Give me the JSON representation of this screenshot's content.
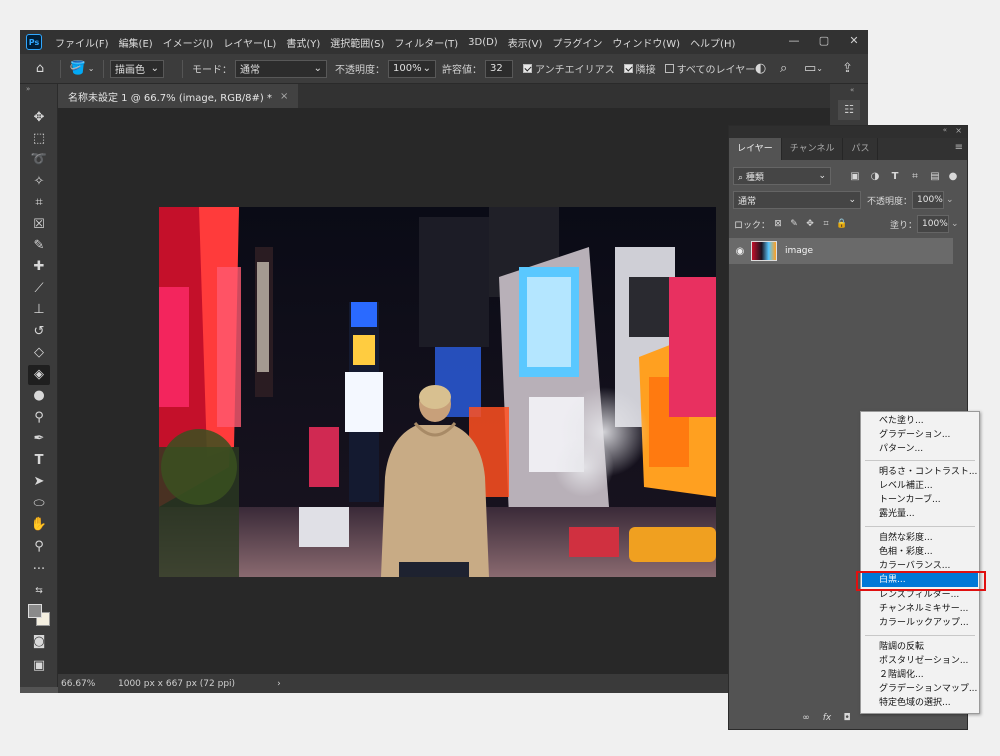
{
  "menubar": {
    "logo": "Ps",
    "items": [
      "ファイル(F)",
      "編集(E)",
      "イメージ(I)",
      "レイヤー(L)",
      "書式(Y)",
      "選択範囲(S)",
      "フィルター(T)",
      "3D(D)",
      "表示(V)",
      "プラグイン",
      "ウィンドウ(W)",
      "ヘルプ(H)"
    ],
    "controls": [
      "—",
      "▢",
      "✕"
    ]
  },
  "options": {
    "fill_source": "描画色",
    "mode_label": "モード：",
    "mode_value": "通常",
    "opacity_label": "不透明度：",
    "opacity_value": "100%",
    "tolerance_label": "許容値：",
    "tolerance_value": "32",
    "antialias_label": "アンチエイリアス",
    "contiguous_label": "隣接",
    "all_layers_label": "すべてのレイヤー"
  },
  "document": {
    "tab_title": "名称未設定 1 @ 66.7% (image, RGB/8#) *",
    "tab_close": "×"
  },
  "status": {
    "zoom": "66.67%",
    "info": "1000 px x 667 px (72 ppi)",
    "arrow": "›"
  },
  "layers_panel": {
    "tabs": [
      "レイヤー",
      "チャンネル",
      "パス"
    ],
    "filter_label": "種類",
    "blend_mode": "通常",
    "opacity_label": "不透明度：",
    "opacity_value": "100%",
    "lock_label": "ロック：",
    "fill_label": "塗り：",
    "fill_value": "100%",
    "layer_name": "image"
  },
  "context_menu": {
    "group1": [
      "べた塗り...",
      "グラデーション...",
      "パターン..."
    ],
    "group2": [
      "明るさ・コントラスト...",
      "レベル補正...",
      "トーンカーブ...",
      "露光量..."
    ],
    "group3": [
      "自然な彩度...",
      "色相・彩度...",
      "カラーバランス...",
      "白黒...",
      "レンズフィルター...",
      "チャンネルミキサー...",
      "カラールックアップ..."
    ],
    "group4": [
      "階調の反転",
      "ポスタリゼーション...",
      "２階調化...",
      "グラデーションマップ...",
      "特定色域の選択..."
    ],
    "highlighted": "白黒..."
  },
  "colors": {
    "highlight": "#0078d7",
    "annotation": "#e01010",
    "workspace": "#282828"
  }
}
